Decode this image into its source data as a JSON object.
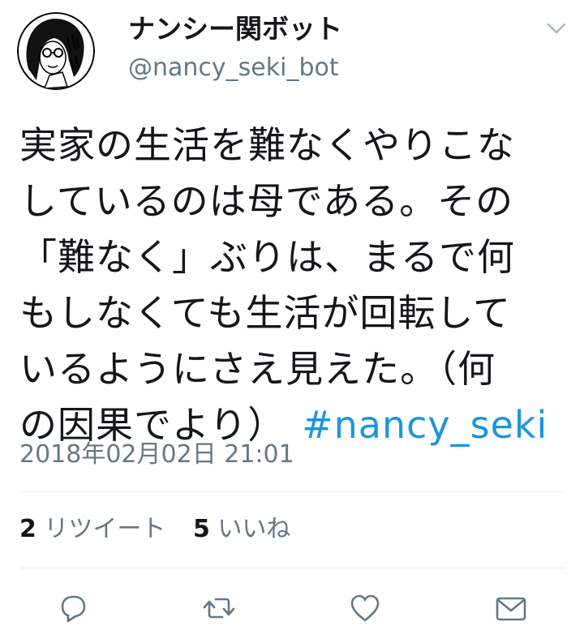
{
  "tweet": {
    "display_name": "ナンシー関ボット",
    "handle": "@nancy_seki_bot",
    "avatar_icon": "portrait-illustration-icon",
    "text_lines": [
      "実家の生活を難なくやりこな",
      "しているのは母である。その",
      "「難なく」ぶりは、まるで何",
      "もしなくても生活が回転して",
      "いるようにさえ見えた。（何",
      "の因果でより）"
    ],
    "hashtag": "#nancy_seki",
    "timestamp": "2018年02月02日 21:01",
    "stats": {
      "retweet_count": "2",
      "retweet_label": "リツイート",
      "like_count": "5",
      "like_label": "いいね"
    }
  },
  "actions": {
    "reply_icon": "reply-icon",
    "retweet_icon": "retweet-icon",
    "like_icon": "heart-icon",
    "dm_icon": "envelope-icon"
  },
  "colors": {
    "text": "#14171a",
    "secondary": "#657786",
    "accent": "#1b95e0",
    "divider": "#e6ecf0"
  }
}
